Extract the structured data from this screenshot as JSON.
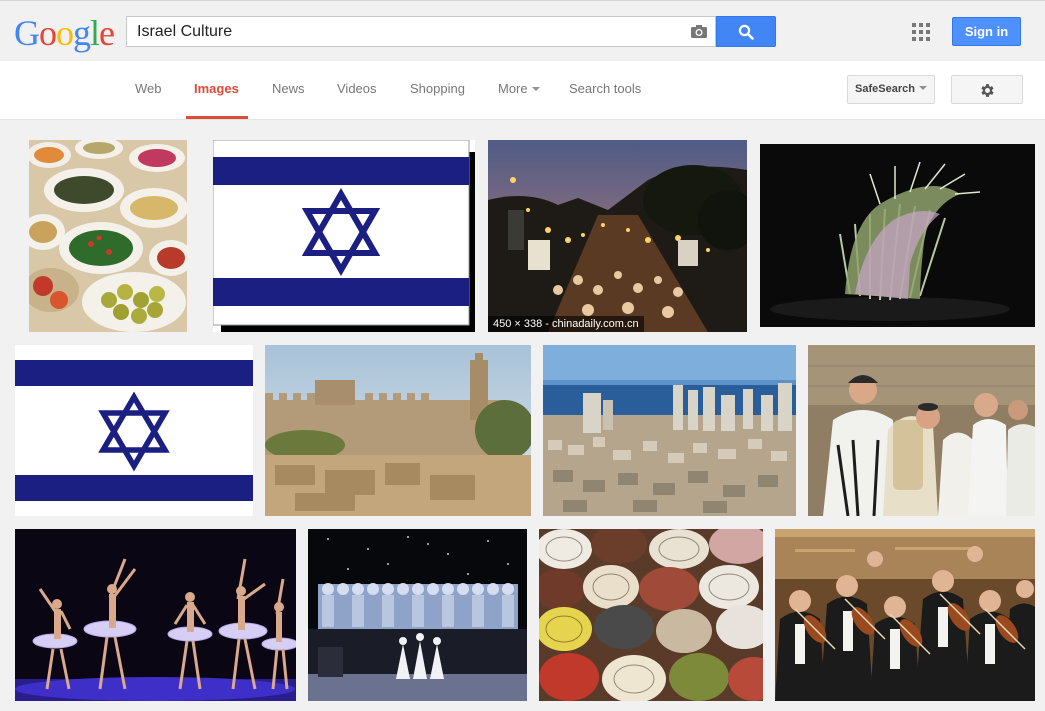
{
  "header": {
    "logo_letters": [
      "G",
      "o",
      "o",
      "g",
      "l",
      "e"
    ],
    "logo_colors": [
      "#4285f4",
      "#ea4335",
      "#fbbc05",
      "#4285f4",
      "#34a853",
      "#ea4335"
    ],
    "search_value": "Israel Culture",
    "signin_label": "Sign in"
  },
  "nav": {
    "tabs": [
      {
        "label": "Web",
        "active": false
      },
      {
        "label": "Images",
        "active": true
      },
      {
        "label": "News",
        "active": false
      },
      {
        "label": "Videos",
        "active": false
      },
      {
        "label": "Shopping",
        "active": false
      },
      {
        "label": "More",
        "active": false
      },
      {
        "label": "Search tools",
        "active": false
      }
    ],
    "safesearch_label": "SafeSearch"
  },
  "results": {
    "items": [
      {
        "subject": "food-platters"
      },
      {
        "subject": "israel-flag-shadow"
      },
      {
        "subject": "night-street-festival",
        "caption": "450 × 338 - chinadaily.com.cn"
      },
      {
        "subject": "dance-sculpture-costume"
      },
      {
        "subject": "israel-flag"
      },
      {
        "subject": "jerusalem-citadel"
      },
      {
        "subject": "tel-aviv-skyline"
      },
      {
        "subject": "prayer-shawl-celebration"
      },
      {
        "subject": "ballet-dancers"
      },
      {
        "subject": "theatre-stage-performance"
      },
      {
        "subject": "kippah-caps"
      },
      {
        "subject": "orchestra-violinists"
      }
    ]
  },
  "colors": {
    "accent_blue": "#4285f4",
    "active_tab": "#dd4b39",
    "flag_blue": "#1b1f82"
  }
}
